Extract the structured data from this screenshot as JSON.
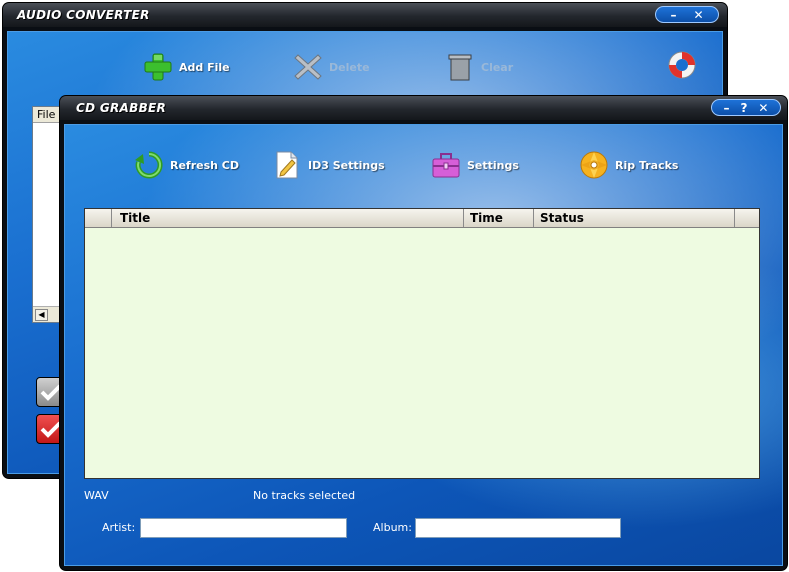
{
  "back_window": {
    "title": "AUDIO CONVERTER",
    "controls": {
      "minimize": "–",
      "close": "✕"
    },
    "toolbar": {
      "add_file": "Add File",
      "delete": "Delete",
      "clear": "Clear"
    },
    "list_header": "File",
    "help_icon": "lifebuoy-icon"
  },
  "front_window": {
    "title": "CD GRABBER",
    "controls": {
      "minimize": "–",
      "help": "?",
      "close": "✕"
    },
    "toolbar": {
      "refresh_cd": "Refresh CD",
      "id3_settings": "ID3 Settings",
      "settings": "Settings",
      "rip_tracks": "Rip Tracks"
    },
    "columns": [
      "",
      "Title",
      "Time",
      "Status",
      ""
    ],
    "rows": [],
    "format": "WAV",
    "selection_status": "No tracks selected",
    "artist_label": "Artist:",
    "artist_value": "",
    "album_label": "Album:",
    "album_value": ""
  },
  "colors": {
    "accent": "#1a6fd0",
    "grid_bg": "#eefbe1",
    "titlebar": "#23272d"
  }
}
